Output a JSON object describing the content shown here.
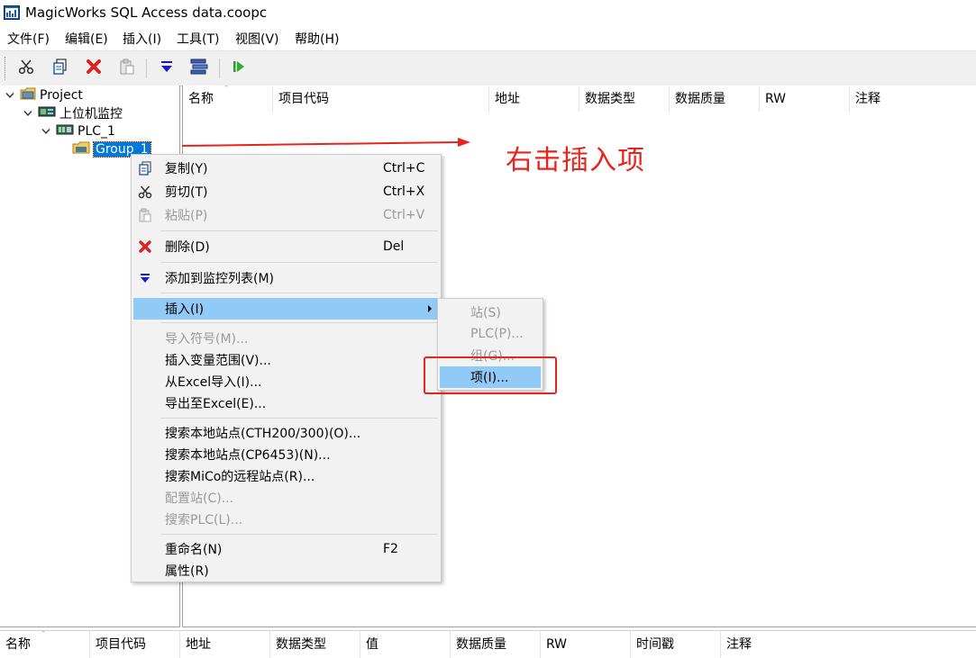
{
  "window": {
    "title": "MagicWorks SQL Access data.coopc"
  },
  "menubar": {
    "items": [
      "文件(F)",
      "编辑(E)",
      "插入(I)",
      "工具(T)",
      "视图(V)",
      "帮助(H)"
    ]
  },
  "toolbar": {
    "icons": [
      "scissors-icon",
      "copy-icon",
      "delete-icon",
      "paste-icon",
      "add-to-watch-icon",
      "list-icon",
      "run-icon"
    ]
  },
  "tree": {
    "root": "Project",
    "station": "上位机监控",
    "plc": "PLC_1",
    "group": "Group_1"
  },
  "main_columns": [
    "名称",
    "项目代码",
    "地址",
    "数据类型",
    "数据质量",
    "RW",
    "注释"
  ],
  "bottom_columns": [
    "名称",
    "项目代码",
    "地址",
    "数据类型",
    "值",
    "数据质量",
    "RW",
    "时间戳",
    "注释"
  ],
  "annotation": {
    "text": "右击插入项",
    "color": "#e8231c"
  },
  "context_menu": {
    "copy": {
      "label": "复制(Y)",
      "shortcut": "Ctrl+C"
    },
    "cut": {
      "label": "剪切(T)",
      "shortcut": "Ctrl+X"
    },
    "paste": {
      "label": "粘贴(P)",
      "shortcut": "Ctrl+V"
    },
    "delete": {
      "label": "删除(D)",
      "shortcut": "Del"
    },
    "add_watch": {
      "label": "添加到监控列表(M)"
    },
    "insert": {
      "label": "插入(I)"
    },
    "import_symbols": {
      "label": "导入符号(M)..."
    },
    "insert_range": {
      "label": "插入变量范围(V)..."
    },
    "import_excel": {
      "label": "从Excel导入(I)..."
    },
    "export_excel": {
      "label": "导出至Excel(E)..."
    },
    "search_cth": {
      "label": "搜索本地站点(CTH200/300)(O)..."
    },
    "search_cp": {
      "label": "搜索本地站点(CP6453)(N)..."
    },
    "search_mico": {
      "label": "搜索MiCo的远程站点(R)..."
    },
    "config_station": {
      "label": "配置站(C)..."
    },
    "search_plc": {
      "label": "搜索PLC(L)..."
    },
    "rename": {
      "label": "重命名(N)",
      "shortcut": "F2"
    },
    "properties": {
      "label": "属性(R)"
    }
  },
  "submenu": {
    "station": "站(S)",
    "plc": "PLC(P)...",
    "group": "组(G)...",
    "item": "项(I)..."
  },
  "colors": {
    "selection": "#0078d7",
    "menu_highlight": "#91c9f7",
    "annotation_red": "#e8231c"
  }
}
